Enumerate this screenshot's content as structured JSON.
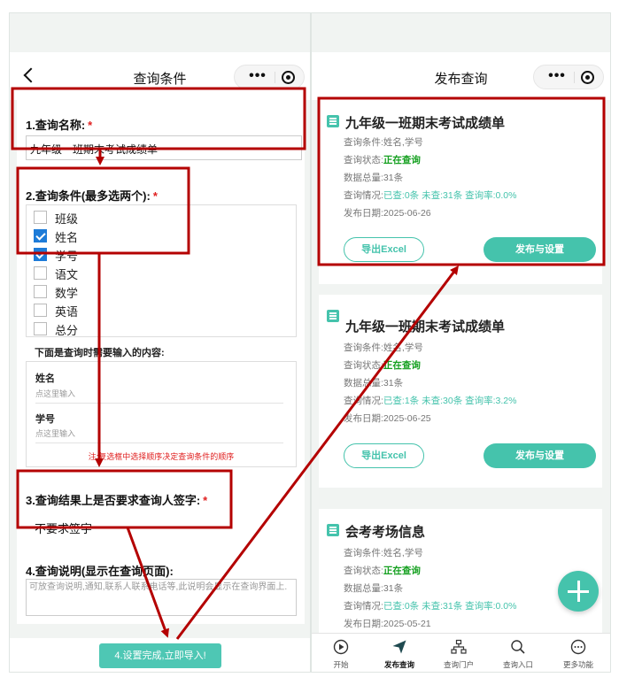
{
  "left": {
    "nav_title": "查询条件",
    "capsule_more": "•••",
    "form": {
      "name_section": {
        "title": "1.查询名称:",
        "required": "*",
        "value": "九年级一班期末考试成绩单"
      },
      "cond_section": {
        "title": "2.查询条件(最多选两个):",
        "required": "*",
        "options": [
          {
            "label": "班级",
            "checked": false
          },
          {
            "label": "姓名",
            "checked": true
          },
          {
            "label": "学号",
            "checked": true
          },
          {
            "label": "语文",
            "checked": false
          },
          {
            "label": "数学",
            "checked": false
          },
          {
            "label": "英语",
            "checked": false
          },
          {
            "label": "总分",
            "checked": false
          }
        ]
      },
      "inputs_title": "下面是查询时需要输入的内容:",
      "fields": [
        {
          "label": "姓名",
          "placeholder": "点这里输入"
        },
        {
          "label": "学号",
          "placeholder": "点这里输入"
        }
      ],
      "order_note": "注:复选框中选择顺序决定查询条件的顺序",
      "sign_section": {
        "title": "3.查询结果上是否要求查询人签字:",
        "required": "*",
        "value": "不要求签字"
      },
      "desc_section": {
        "title": "4.查询说明(显示在查询页面):",
        "placeholder": "可放查询说明,通知,联系人联系电话等,此说明会显示在查询界面上."
      }
    },
    "import_button": "4.设置完成,立即导入!"
  },
  "right": {
    "nav_title": "发布查询",
    "capsule_more": "•••",
    "labels": {
      "cond": "查询条件:",
      "status": "查询状态:",
      "total": "数据总量:",
      "stats": "查询情况:",
      "date": "发布日期:"
    },
    "cards": [
      {
        "title": "九年级一班期末考试成绩单",
        "cond": "姓名,学号",
        "status": "正在查询",
        "total": "31条",
        "stats": "已查:0条 未查:31条 查询率:0.0%",
        "date": "2025-06-26",
        "export": "导出Excel",
        "publish": "发布与设置"
      },
      {
        "title": "九年级一班期末考试成绩单",
        "cond": "姓名,学号",
        "status": "正在查询",
        "total": "31条",
        "stats": "已查:1条 未查:30条 查询率:3.2%",
        "date": "2025-06-25",
        "export": "导出Excel",
        "publish": "发布与设置"
      },
      {
        "title": "会考考场信息",
        "cond": "姓名,学号",
        "status": "正在查询",
        "total": "31条",
        "stats": "已查:0条 未查:31条 查询率:0.0%",
        "date": "2025-05-21"
      }
    ],
    "tabs": [
      {
        "label": "开始",
        "icon": "play-circle-icon"
      },
      {
        "label": "发布查询",
        "icon": "paper-plane-icon"
      },
      {
        "label": "查询门户",
        "icon": "sitemap-icon"
      },
      {
        "label": "查询入口",
        "icon": "search-icon"
      },
      {
        "label": "更多功能",
        "icon": "more-circle-icon"
      }
    ]
  },
  "colors": {
    "accent": "#45c3ac",
    "annotation": "#b40000",
    "required": "#e02020",
    "status_green": "#15a020",
    "checkbox": "#1d7bd8"
  }
}
